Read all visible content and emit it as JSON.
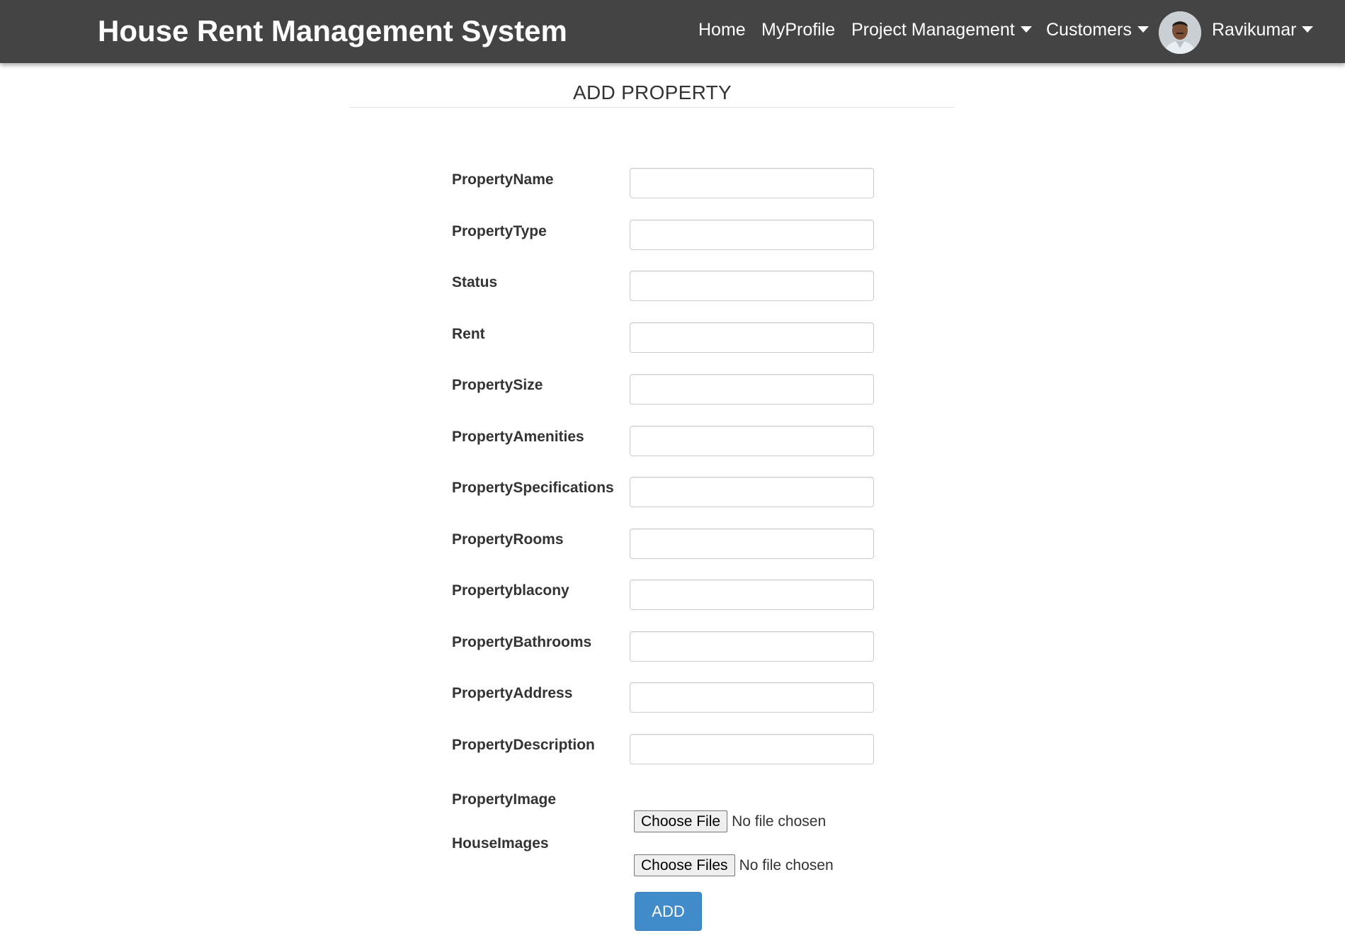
{
  "navbar": {
    "brand": "House Rent Management System",
    "links": {
      "home": "Home",
      "profile": "MyProfile",
      "project_management": "Project Management",
      "customers": "Customers",
      "user": "Ravikumar"
    },
    "avatar_icon": "user-photo"
  },
  "page": {
    "title": "ADD PROPERTY"
  },
  "form": {
    "fields": [
      {
        "label": "PropertyName",
        "value": ""
      },
      {
        "label": "PropertyType",
        "value": ""
      },
      {
        "label": "Status",
        "value": ""
      },
      {
        "label": "Rent",
        "value": ""
      },
      {
        "label": "PropertySize",
        "value": ""
      },
      {
        "label": "PropertyAmenities",
        "value": ""
      },
      {
        "label": "PropertySpecifications",
        "value": ""
      },
      {
        "label": "PropertyRooms",
        "value": ""
      },
      {
        "label": "Propertyblacony",
        "value": ""
      },
      {
        "label": "PropertyBathrooms",
        "value": ""
      },
      {
        "label": "PropertyAddress",
        "value": ""
      },
      {
        "label": "PropertyDescription",
        "value": ""
      }
    ],
    "property_image": {
      "label": "PropertyImage",
      "button": "Choose File",
      "status": "No file chosen"
    },
    "house_images": {
      "label": "HouseImages",
      "button": "Choose Files",
      "status": "No file chosen"
    },
    "submit": "ADD"
  },
  "colors": {
    "navbar_bg": "#444444",
    "primary_button": "#428bca"
  }
}
